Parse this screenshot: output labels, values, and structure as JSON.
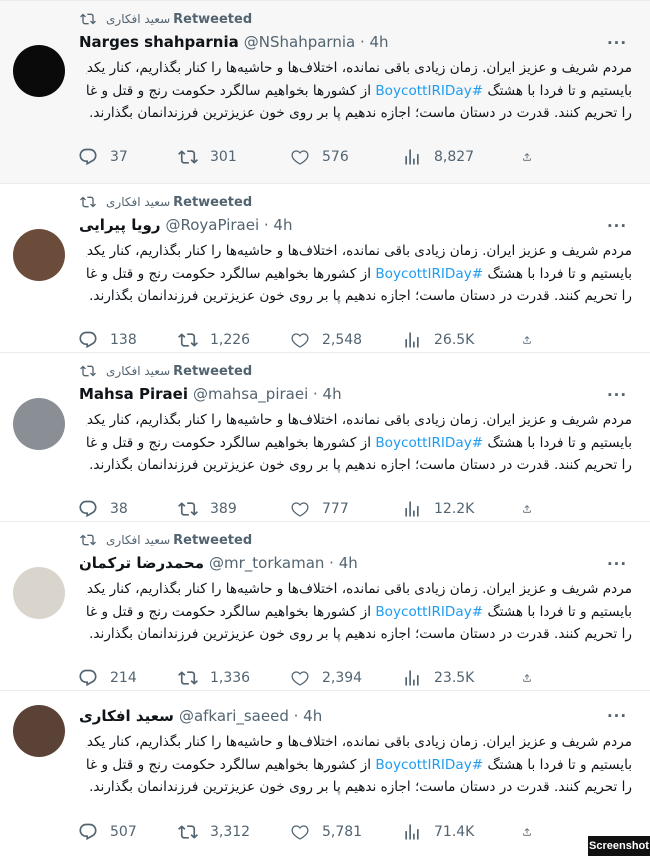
{
  "retweeter": "سعید افکاری",
  "retweeted_label": "Retweeted",
  "tweet_text": {
    "line1": "مردم شریف و عزیز ایران. زمان زیادی باقی نمانده، اختلاف‌ها و حاشیه‌ها را کنار بگذاریم، کنار یکدیگر",
    "line2_pre": "بایستیم و تا فردا با هشتگ ",
    "hashtag": "#BoycottIRIDay",
    "line2_post": " از کشورها بخواهیم سالگرد حکومت رنج و قتل و غارت",
    "line3": "را تحریم کنند. قدرت در دستان ماست؛ اجازه ندهیم پا بر روی خون عزیزترین فرزندانمان بگذارند."
  },
  "tweets": [
    {
      "name": "Narges shahparnia",
      "handle": "@NShahparnia · 4h",
      "retweeted": true,
      "replies": "37",
      "retweets": "301",
      "likes": "576",
      "views": "8,827"
    },
    {
      "name": "رویا پیرایی",
      "handle": "@RoyaPiraei · 4h",
      "retweeted": true,
      "replies": "138",
      "retweets": "1,226",
      "likes": "2,548",
      "views": "26.5K"
    },
    {
      "name": "Mahsa Piraei",
      "handle": "@mahsa_piraei · 4h",
      "retweeted": true,
      "replies": "38",
      "retweets": "389",
      "likes": "777",
      "views": "12.2K"
    },
    {
      "name": "محمدرضا ترکمان",
      "handle": "@mr_torkaman · 4h",
      "retweeted": true,
      "replies": "214",
      "retweets": "1,336",
      "likes": "2,394",
      "views": "23.5K"
    },
    {
      "name": "سعید افکاری",
      "handle": "@afkari_saeed · 4h",
      "retweeted": false,
      "replies": "507",
      "retweets": "3,312",
      "likes": "5,781",
      "views": "71.4K"
    }
  ],
  "icons": {
    "retweet": "retweet-icon",
    "reply": "reply-icon",
    "like": "heart-icon",
    "views": "views-icon",
    "share": "share-icon",
    "more": "more-icon"
  },
  "colors": {
    "hashtag": "#1d9bf0",
    "muted": "#536471",
    "highlight_bg": "#f7f7f7"
  },
  "watermark": "Screenshot"
}
